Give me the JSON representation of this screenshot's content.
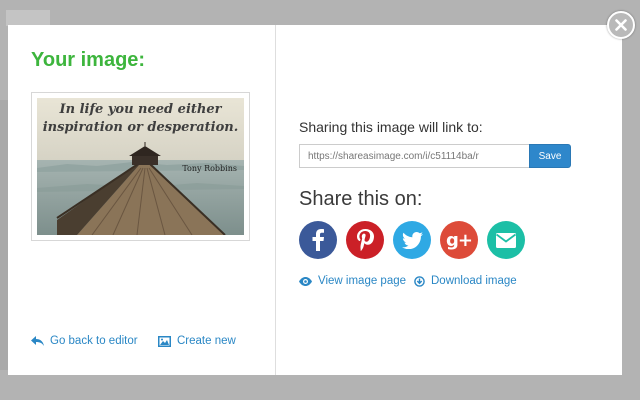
{
  "left_panel": {
    "title": "Your image:",
    "preview": {
      "quote_line1": "In life you need either",
      "quote_line2": "inspiration or desperation.",
      "author": "Tony Robbins"
    },
    "back_link_label": "Go back to editor",
    "create_link_label": "Create new"
  },
  "right_panel": {
    "sharing_label": "Sharing this image will link to:",
    "url_value": "https://shareasimage.com/i/c51114ba/r",
    "save_label": "Save",
    "share_title": "Share this on:",
    "social_icons": [
      "facebook-icon",
      "pinterest-icon",
      "twitter-icon",
      "google-plus-icon",
      "email-icon"
    ],
    "view_link_label": "View image page",
    "download_link_label": "Download image"
  },
  "colors": {
    "accent_green": "#3db53d",
    "link_blue": "#2a87c5",
    "save_blue": "#2e87cb",
    "facebook": "#3b5999",
    "pinterest": "#cb2027",
    "twitter": "#2fa9e4",
    "google_plus": "#dd4b39",
    "email": "#1cbfa6"
  }
}
